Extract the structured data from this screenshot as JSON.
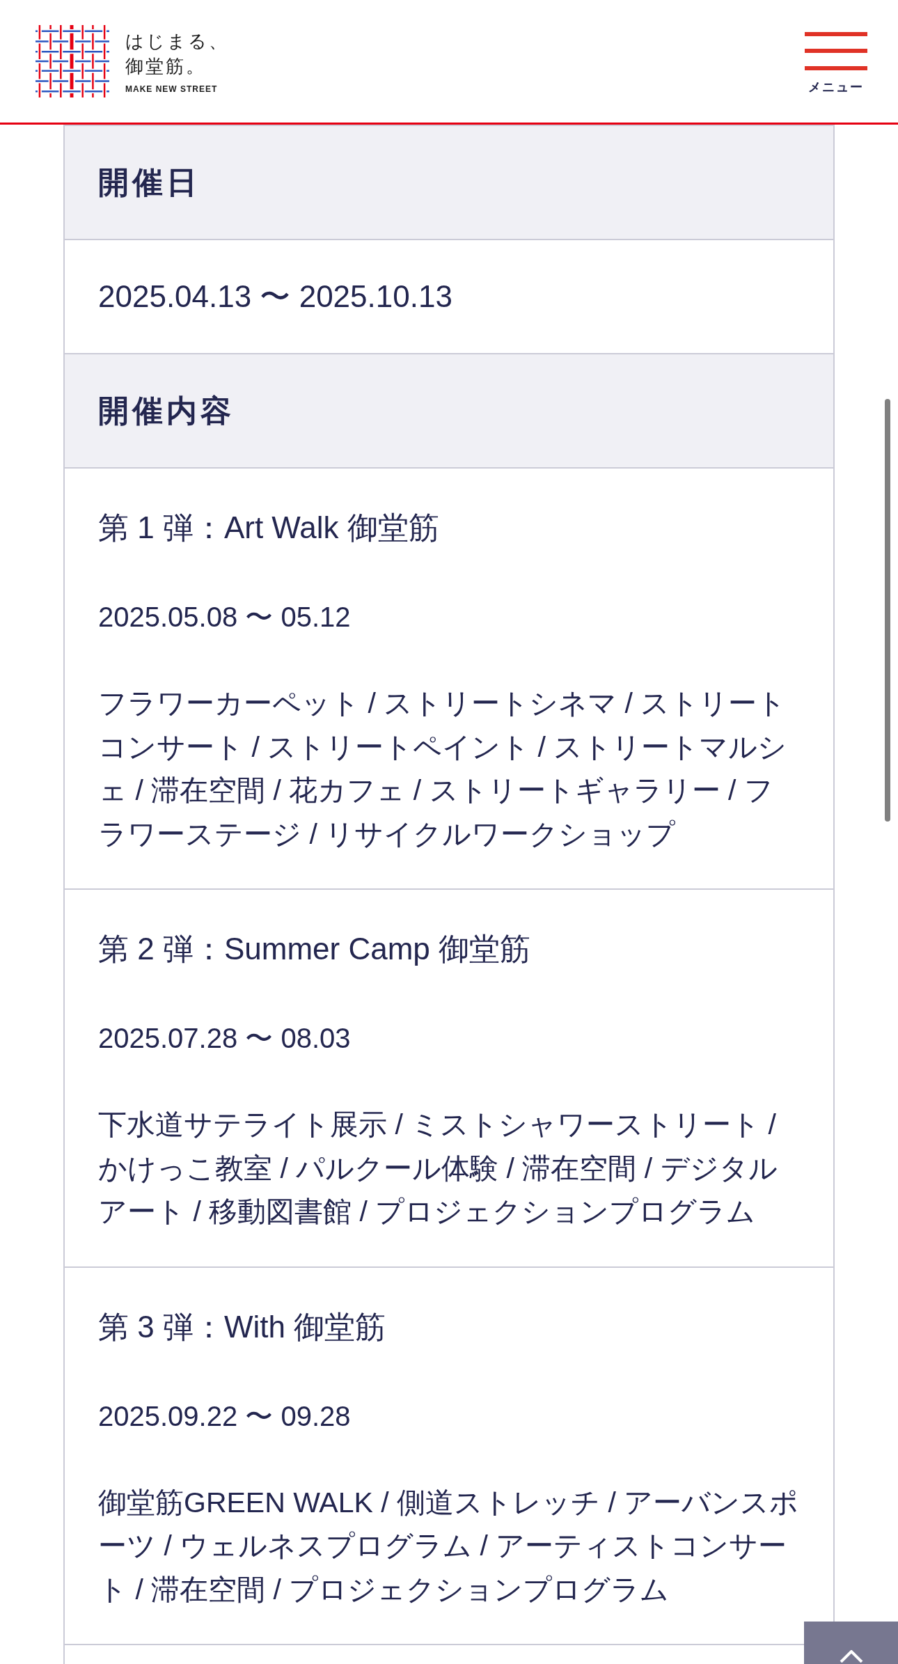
{
  "header": {
    "logo": {
      "title_lines": [
        "はじまる、",
        "御堂筋。"
      ],
      "tagline": "MAKE NEW STREET"
    },
    "menu_button": {
      "label": "メニュー"
    }
  },
  "table": {
    "rows": [
      {
        "kind": "heading",
        "text": "開催日"
      },
      {
        "kind": "value",
        "text": "2025.04.13 〜 2025.10.13"
      },
      {
        "kind": "heading",
        "text": "開催内容"
      },
      {
        "kind": "event",
        "title": "第 1 弾：Art Walk 御堂筋",
        "dates": "2025.05.08 〜 05.12",
        "programs": "フラワーカーペット / ストリートシネマ / ストリートコンサート / ストリートペイント / ストリートマルシェ / 滞在空間 / 花カフェ / ストリートギャラリー / フラワーステージ / リサイクルワークショップ"
      },
      {
        "kind": "event",
        "title": "第 2 弾：Summer Camp 御堂筋",
        "dates": "2025.07.28 〜 08.03",
        "programs": "下水道サテライト展示 / ミストシャワーストリート / かけっこ教室 / パルクール体験 / 滞在空間 / デジタルアート / 移動図書館 / プロジェクションプログラム"
      },
      {
        "kind": "event",
        "title": "第 3 弾：With 御堂筋",
        "dates": "2025.09.22 〜 09.28",
        "programs": "御堂筋GREEN WALK / 側道ストレッチ / アーバンスポーツ / ウェルネスプログラム / アーティストコンサート / 滞在空間 / プロジェクションプログラム"
      }
    ]
  }
}
